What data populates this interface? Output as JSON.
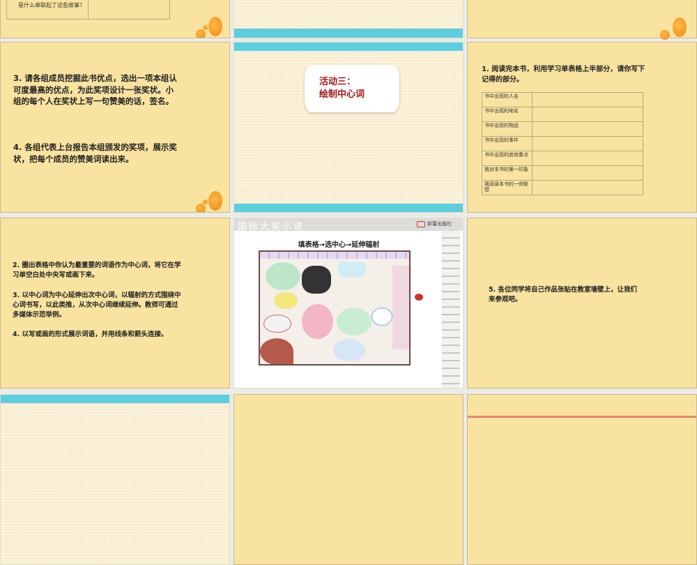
{
  "slides": {
    "s0_left": {
      "table_text": "是什么串联起了这些故事？"
    },
    "s1_left": {
      "para1": "3. 请各组成员挖掘此书优点，选出一项本组认可度最高的优点，为此奖项设计一张奖状。小组的每个人在奖状上写一句赞美的话，签名。",
      "para2": "4. 各组代表上台报告本组颁发的奖项，展示奖状，把每个成员的赞美词读出来。"
    },
    "s1_mid": {
      "title_line1": "活动三：",
      "title_line2": "绘制中心词"
    },
    "s1_right": {
      "intro": "1. 阅读完本书，利用学习单表格上半部分，请你写下记得的部分。",
      "rows": [
        "书中出现的人名",
        "书中出现的地名",
        "书中出现的物品",
        "书中出现的事件",
        "书中出现的其他重点",
        "我对本书的第一印象",
        "我阅读本书的一些联想"
      ]
    },
    "s2_left": {
      "para1": "2. 圈出表格中你认为最重要的词语作为中心词，将它在学习单空白处中央写或画下来。",
      "para2": "3. 以中心词为中心延伸出次中心词，以辐射的方式围绕中心词书写，以此类推，从次中心词继续延伸。教师可通过多媒体示范举例。",
      "para3": "4. 以写或画的形式展示词语，并用线条和箭头连接。"
    },
    "s2_mid": {
      "header": "国际大奖小说",
      "publisher": "新蕾出版社",
      "subtitle": "填表格→选中心→延伸辐射"
    },
    "s2_right": {
      "text": "5. 各位同学将自己作品张贴在教室墙壁上，让我们来参观吧。"
    }
  },
  "colors": {
    "slide_bg": "#f9e3a0",
    "cyan": "#5ccee0",
    "accent_red": "#a31515"
  }
}
